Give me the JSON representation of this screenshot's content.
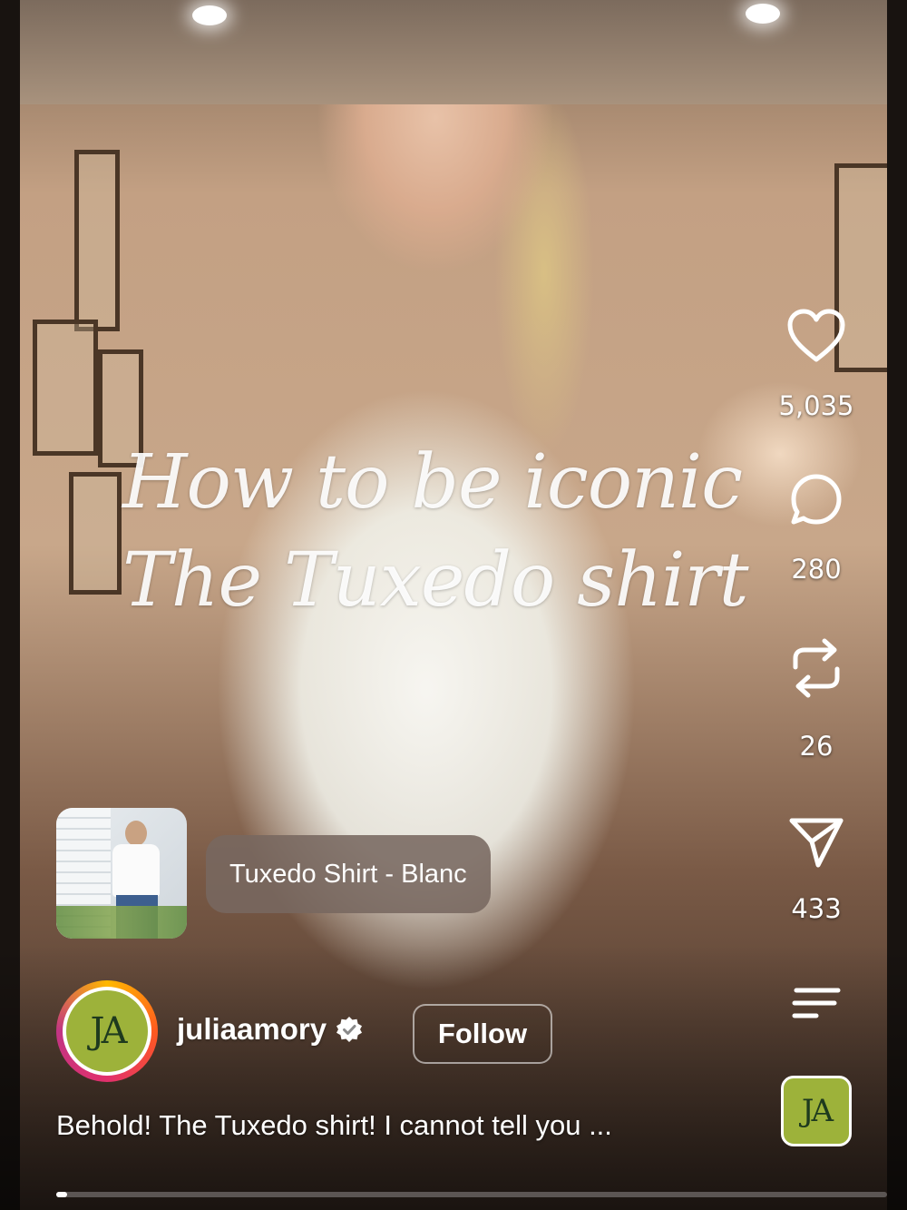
{
  "overlay_title": {
    "line1": "How to be iconic",
    "line2": "The Tuxedo shirt"
  },
  "actions": {
    "likes": "5,035",
    "comments": "280",
    "reposts": "26",
    "shares": "433"
  },
  "product_tag": {
    "label": "Tuxedo Shirt - Blanc"
  },
  "profile": {
    "avatar_initials": "JA",
    "username": "juliaamory",
    "verified": true,
    "follow_label": "Follow"
  },
  "caption": "Behold! The Tuxedo shirt! I cannot tell you ...",
  "audio": {
    "thumb_initials": "JA"
  },
  "progress": 0.012,
  "colors": {
    "avatar_bg": "#9db23a",
    "text": "#ffffff"
  },
  "icons": {
    "like": "heart-icon",
    "comment": "comment-icon",
    "repost": "repost-icon",
    "share": "send-icon",
    "more": "menu-icon",
    "verified": "verified-badge-icon"
  }
}
